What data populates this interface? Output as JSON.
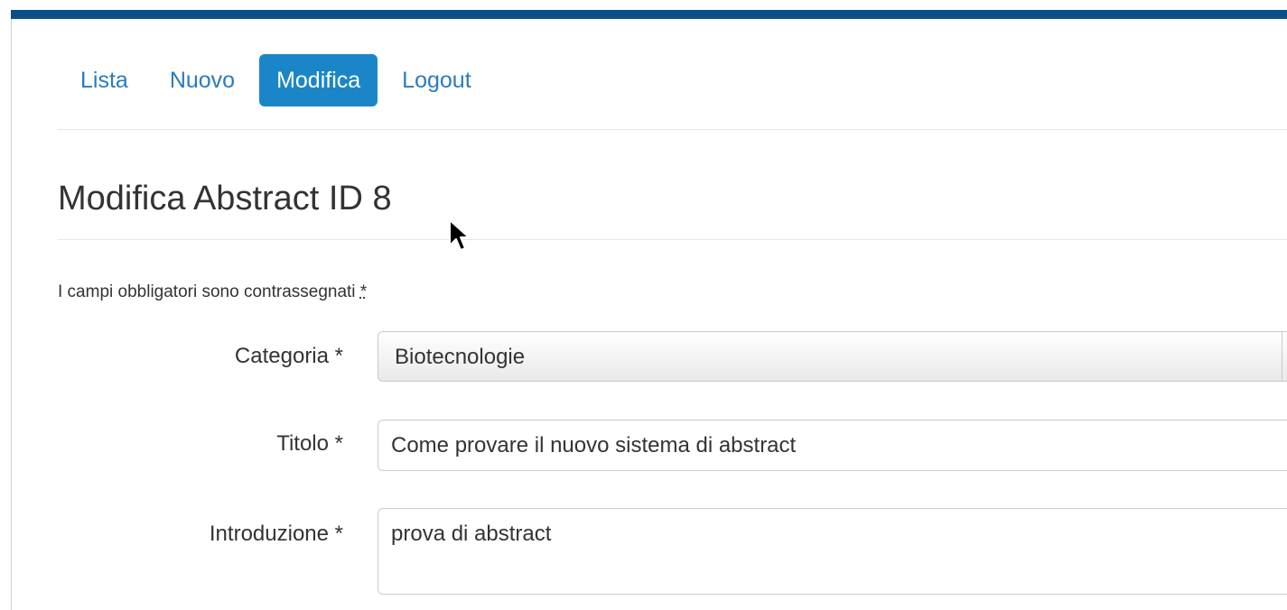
{
  "nav": {
    "items": [
      {
        "label": "Lista",
        "active": false
      },
      {
        "label": "Nuovo",
        "active": false
      },
      {
        "label": "Modifica",
        "active": true
      },
      {
        "label": "Logout",
        "active": false
      }
    ]
  },
  "page": {
    "title": "Modifica Abstract ID 8",
    "required_note": "I campi obbligatori sono contrassegnati",
    "required_star": "*"
  },
  "form": {
    "categoria": {
      "label": "Categoria *",
      "value": "Biotecnologie"
    },
    "titolo": {
      "label": "Titolo *",
      "value": "Come provare il nuovo sistema di abstract"
    },
    "introduzione": {
      "label": "Introduzione *",
      "value": "prova di abstract"
    }
  },
  "colors": {
    "topbar": "#0b4f8a",
    "nav_link": "#2a7bbf",
    "nav_active_bg": "#1b86c7"
  }
}
